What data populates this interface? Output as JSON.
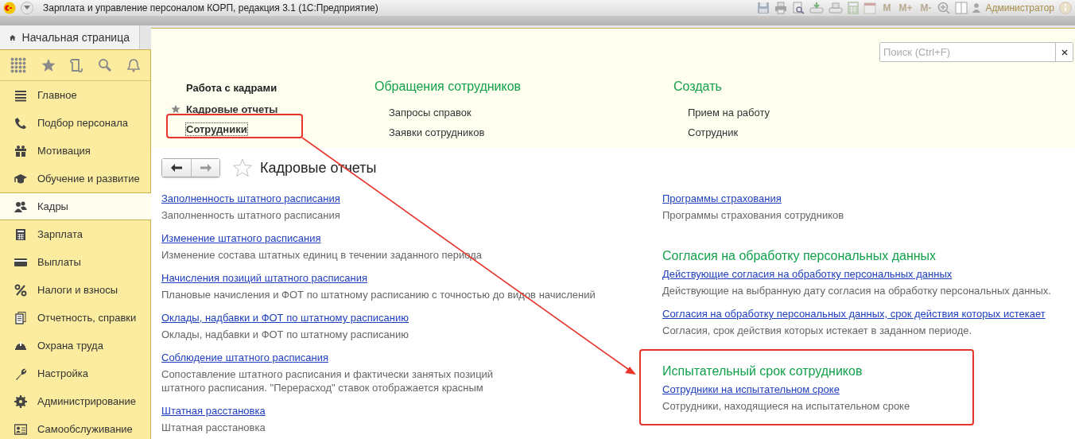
{
  "window": {
    "title": "Зарплата и управление персоналом КОРП, редакция 3.1  (1С:Предприятие)",
    "memory_buttons": [
      "M",
      "M+",
      "M-"
    ],
    "user": "Администратор"
  },
  "tabs": [
    {
      "label": "Начальная страница"
    }
  ],
  "sidebar": {
    "items": [
      {
        "label": "Главное",
        "selected": false
      },
      {
        "label": "Подбор персонала",
        "selected": false
      },
      {
        "label": "Мотивация",
        "selected": false
      },
      {
        "label": "Обучение и развитие",
        "selected": false
      },
      {
        "label": "Кадры",
        "selected": true
      },
      {
        "label": "Зарплата",
        "selected": false
      },
      {
        "label": "Выплаты",
        "selected": false
      },
      {
        "label": "Налоги и взносы",
        "selected": false
      },
      {
        "label": "Отчетность, справки",
        "selected": false
      },
      {
        "label": "Охрана труда",
        "selected": false
      },
      {
        "label": "Настройка",
        "selected": false
      },
      {
        "label": "Администрирование",
        "selected": false
      },
      {
        "label": "Самообслуживание",
        "selected": false
      }
    ]
  },
  "section_menu": {
    "search": {
      "placeholder": "Поиск (Ctrl+F)"
    },
    "columns": [
      {
        "kind": "main",
        "heading": "Работа с кадрами",
        "items": [
          {
            "label": "Кадровые отчеты",
            "starred": true,
            "focused": false
          },
          {
            "label": "Сотрудники",
            "starred": false,
            "focused": true
          }
        ]
      },
      {
        "kind": "section",
        "heading": "Обращения сотрудников",
        "items": [
          {
            "label": "Запросы справок",
            "starred": false,
            "focused": false
          },
          {
            "label": "Заявки сотрудников",
            "starred": false,
            "focused": false
          }
        ]
      },
      {
        "kind": "section",
        "heading": "Создать",
        "items": [
          {
            "label": "Прием на работу",
            "starred": false,
            "focused": false
          },
          {
            "label": "Сотрудник",
            "starred": false,
            "focused": false
          }
        ]
      }
    ]
  },
  "report_panel": {
    "title": "Кадровые отчеты",
    "favorite": false,
    "left": [
      {
        "kind": "report",
        "link": "Заполненность штатного расписания",
        "description": "Заполненность штатного расписания"
      },
      {
        "kind": "report",
        "link": "Изменение штатного расписания",
        "description": "Изменение состава штатных единиц в течении заданного периода"
      },
      {
        "kind": "report",
        "link": "Начисления позиций штатного расписания",
        "description": "Плановые начисления и ФОТ по штатному расписанию с точностью до видов начислений"
      },
      {
        "kind": "report",
        "link": "Оклады, надбавки и ФОТ по штатному расписанию",
        "description": "Оклады, надбавки и ФОТ по штатному расписанию"
      },
      {
        "kind": "report",
        "link": "Соблюдение штатного расписания",
        "description": "Сопоставление штатного расписания и фактически занятых позиций\nштатного расписания. \"Перерасход\" ставок отображается красным"
      },
      {
        "kind": "report",
        "link": "Штатная расстановка",
        "description": "Штатная расстановка"
      }
    ],
    "right": [
      {
        "kind": "report",
        "link": "Программы страхования",
        "description": "Программы страхования сотрудников"
      },
      {
        "kind": "heading",
        "text": "Согласия на обработку персональных данных"
      },
      {
        "kind": "report",
        "link": "Действующие согласия на обработку персональных данных",
        "description": "Действующие на выбранную дату согласия на обработку персональных данных."
      },
      {
        "kind": "report",
        "link": "Согласия на обработку персональных данных, срок действия которых истекает",
        "description": "Согласия, срок действия которых истекает в заданном периоде."
      },
      {
        "kind": "heading",
        "text": "Испытательный срок сотрудников"
      },
      {
        "kind": "report",
        "link": "Сотрудники на испытательном сроке",
        "description": "Сотрудники, находящиеся на испытательном сроке"
      }
    ]
  }
}
